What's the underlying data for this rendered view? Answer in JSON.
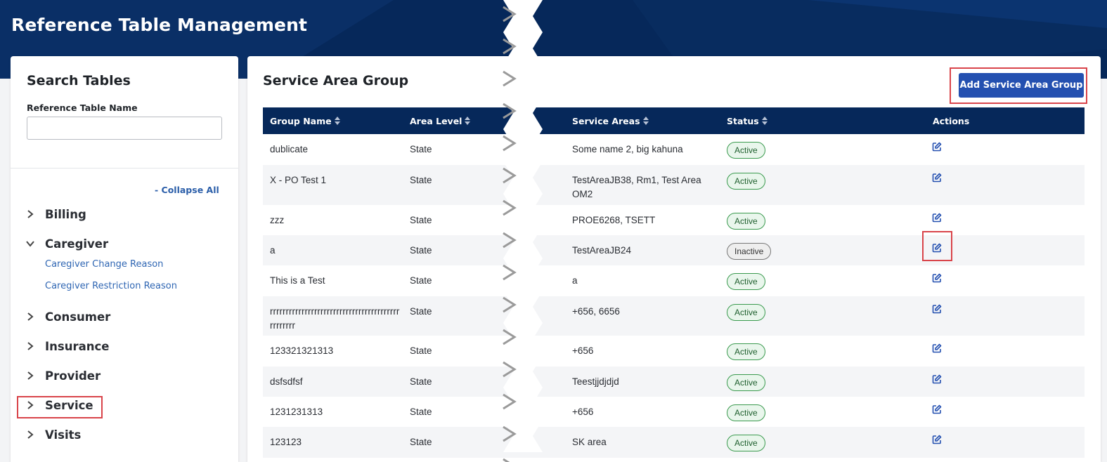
{
  "header": {
    "title": "Reference Table Management"
  },
  "colors": {
    "navy": "#06285a",
    "accent": "#2450b0",
    "link": "#2f66b3",
    "highlight": "#d9444a"
  },
  "sidebar": {
    "title": "Search Tables",
    "search_label": "Reference Table Name",
    "search_value": "",
    "collapse_all": "- Collapse All",
    "categories": [
      {
        "label": "Billing",
        "expanded": false,
        "icon": "chevron-right-icon"
      },
      {
        "label": "Caregiver",
        "expanded": true,
        "icon": "chevron-down-icon",
        "items": [
          "Caregiver Change Reason",
          "Caregiver Restriction Reason"
        ]
      },
      {
        "label": "Consumer",
        "expanded": false,
        "icon": "chevron-right-icon"
      },
      {
        "label": "Insurance",
        "expanded": false,
        "icon": "chevron-right-icon"
      },
      {
        "label": "Provider",
        "expanded": false,
        "icon": "chevron-right-icon"
      },
      {
        "label": "Service",
        "expanded": false,
        "icon": "chevron-right-icon"
      },
      {
        "label": "Visits",
        "expanded": false,
        "icon": "chevron-right-icon"
      }
    ]
  },
  "main": {
    "title": "Service Area Group",
    "add_button": "Add Service Area Group",
    "columns": [
      "Group Name",
      "Area Level",
      "Service Areas",
      "Status",
      "Actions"
    ],
    "rows": [
      {
        "group": "dublicate",
        "level": "State",
        "areas": "Some name 2, big kahuna",
        "status": "Active"
      },
      {
        "group": "X - PO Test 1",
        "level": "State",
        "areas": "TestAreaJB38, Rm1, Test Area OM2",
        "status": "Active"
      },
      {
        "group": "zzz",
        "level": "State",
        "areas": "PROE6268, TSETT",
        "status": "Active"
      },
      {
        "group": "a",
        "level": "State",
        "areas": "TestAreaJB24",
        "status": "Inactive"
      },
      {
        "group": "This is a Test",
        "level": "State",
        "areas": "a",
        "status": "Active"
      },
      {
        "group": "rrrrrrrrrrrrrrrrrrrrrrrrrrrrrrrrrrrrrrrrrrrrrrrrr",
        "level": "State",
        "areas": "+656, 6656",
        "status": "Active"
      },
      {
        "group": "123321321313",
        "level": "State",
        "areas": "+656",
        "status": "Active"
      },
      {
        "group": "dsfsdfsf",
        "level": "State",
        "areas": "Teestjjdjdjd",
        "status": "Active"
      },
      {
        "group": "1231231313",
        "level": "State",
        "areas": "+656",
        "status": "Active"
      },
      {
        "group": "123123",
        "level": "State",
        "areas": "SK area",
        "status": "Active"
      }
    ],
    "action_icon": "edit-icon"
  }
}
